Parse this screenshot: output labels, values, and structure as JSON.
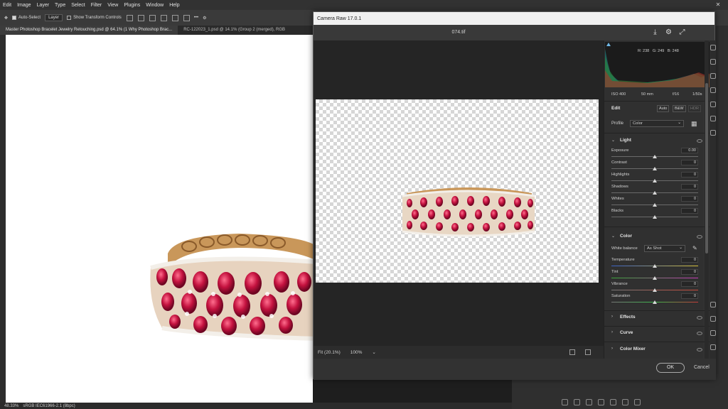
{
  "menu": [
    "Edit",
    "Image",
    "Layer",
    "Type",
    "Select",
    "Filter",
    "View",
    "Plugins",
    "Window",
    "Help"
  ],
  "options": {
    "auto_select": "Auto-Select",
    "layer_select": "Layer",
    "show_transform": "Show Transform Controls",
    "more": "•••"
  },
  "doc_tabs": [
    "Master Photoshop Bracelet Jewelry Retouching.psd @ 64.1% (1 Why Photoshop Brac...",
    "RC-122023_1.psd @ 14.1% (Group 2 (merged), RGB"
  ],
  "status": {
    "zoom": "48.33%",
    "profile": "sRGB IEC61966-2.1 (8bpc)"
  },
  "camera_raw": {
    "title": "Camera Raw 17.0.1",
    "filename": "074.tif",
    "readout": {
      "r": "R: 238",
      "g": "G: 249",
      "b": "B: 248"
    },
    "exif": {
      "iso": "ISO 400",
      "focal": "50 mm",
      "aperture": "f/16",
      "shutter": "1/50s"
    },
    "edit_label": "Edit",
    "auto": "Auto",
    "bw": "B&W",
    "hdr": "HDR",
    "profile_label": "Profile",
    "profile_value": "Color",
    "light": {
      "title": "Light",
      "sliders": [
        {
          "label": "Exposure",
          "value": "0.00",
          "pos": 0.5
        },
        {
          "label": "Contrast",
          "value": "0",
          "pos": 0.5
        },
        {
          "label": "Highlights",
          "value": "0",
          "pos": 0.5
        },
        {
          "label": "Shadows",
          "value": "0",
          "pos": 0.5
        },
        {
          "label": "Whites",
          "value": "0",
          "pos": 0.5
        },
        {
          "label": "Blacks",
          "value": "0",
          "pos": 0.5
        }
      ]
    },
    "color": {
      "title": "Color",
      "wb_label": "White balance",
      "wb_value": "As Shot",
      "sliders": [
        {
          "label": "Temperature",
          "value": "0",
          "pos": 0.5
        },
        {
          "label": "Tint",
          "value": "0",
          "pos": 0.5
        },
        {
          "label": "Vibrance",
          "value": "0",
          "pos": 0.5
        },
        {
          "label": "Saturation",
          "value": "0",
          "pos": 0.5
        }
      ]
    },
    "collapsed": [
      "Effects",
      "Curve",
      "Color Mixer"
    ],
    "zoom_fit": "Fit (20.1%)",
    "zoom_100": "100%",
    "ok": "OK",
    "cancel": "Cancel"
  },
  "colors": {
    "ruby": "#c4123f",
    "gold": "#c9975a",
    "accent": "#4aa3df"
  }
}
